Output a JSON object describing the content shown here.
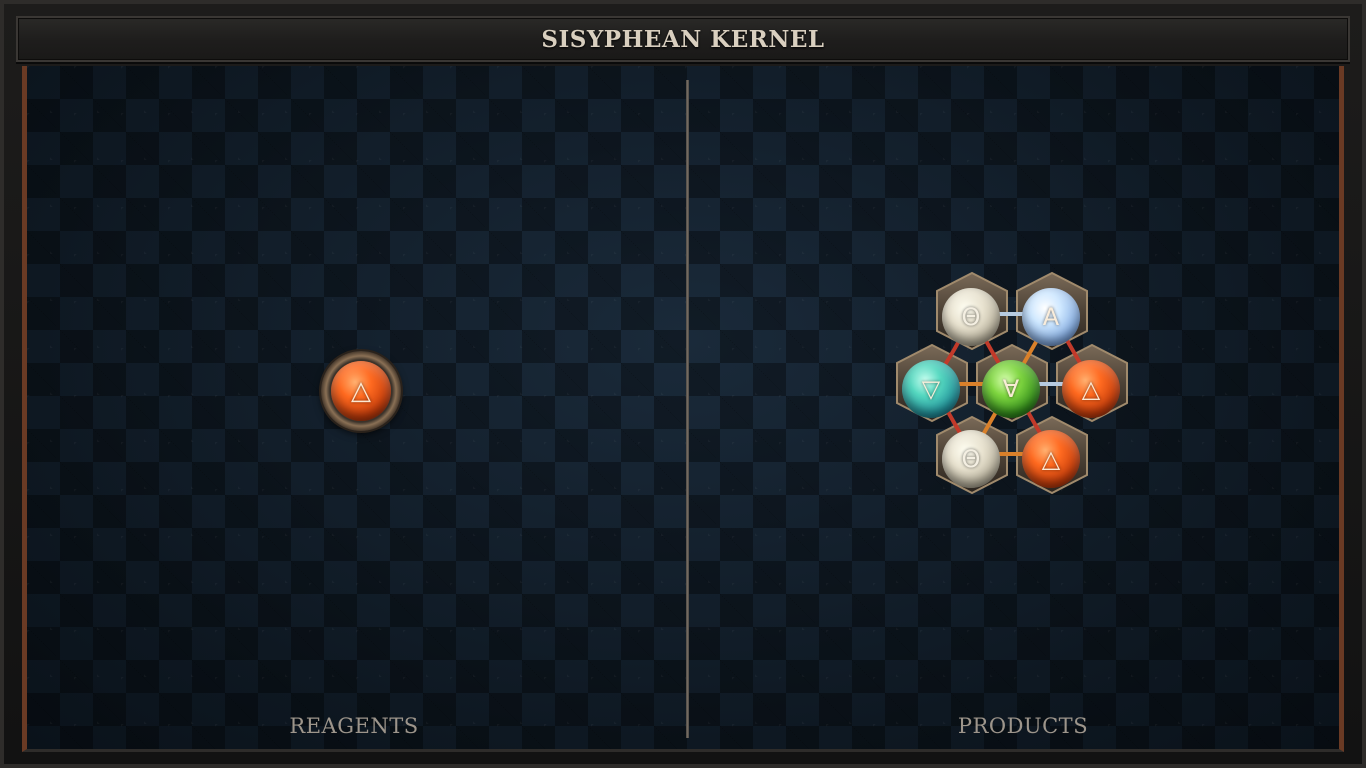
{
  "window": {
    "title": "SISYPHEAN KERNEL"
  },
  "panels": {
    "reagents": {
      "label": "REAGENTS"
    },
    "products": {
      "label": "PRODUCTS"
    }
  },
  "reagent_orbs": [
    {
      "element": "fire",
      "symbol": "△",
      "color": "#d9480f"
    }
  ],
  "product_molecule": {
    "orbs": [
      {
        "element": "salt",
        "symbol": "Θ",
        "color": "#d8d2bf"
      },
      {
        "element": "air",
        "symbol": "A",
        "color": "#9fc3ff"
      },
      {
        "element": "water",
        "symbol": "▽",
        "color": "#3fb6a8"
      },
      {
        "element": "earth",
        "symbol": "∀",
        "color": "#4caf2a"
      },
      {
        "element": "fire",
        "symbol": "△",
        "color": "#d9480f"
      },
      {
        "element": "salt",
        "symbol": "Θ",
        "color": "#d8d2bf"
      },
      {
        "element": "fire",
        "symbol": "△",
        "color": "#d9480f"
      }
    ]
  },
  "colors": {
    "frame_accent": "#6a3a24",
    "board_background": "#0f1a24",
    "label_text": "#9d958b",
    "title_text": "#d9cfbf"
  }
}
